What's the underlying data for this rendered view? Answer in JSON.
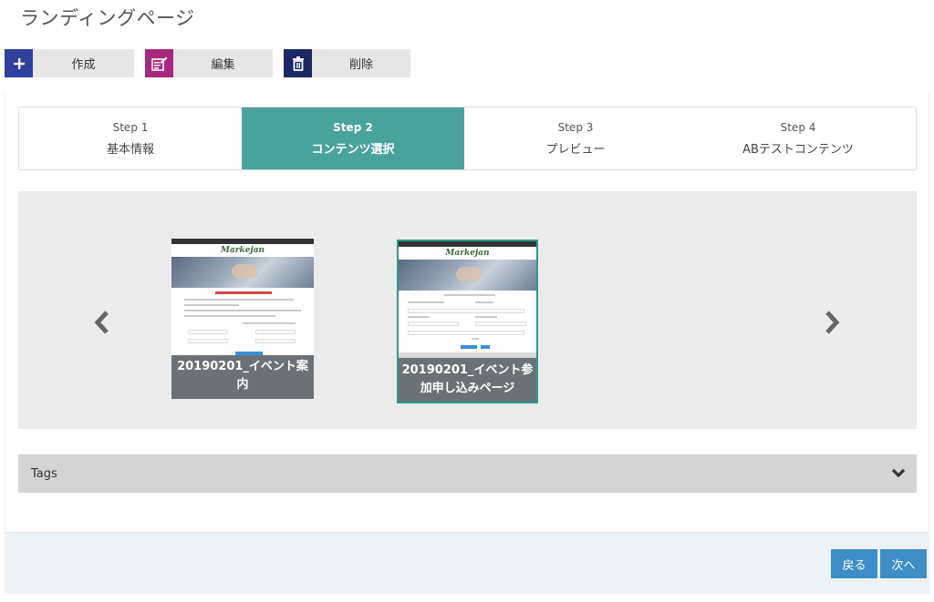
{
  "page": {
    "title": "ランディングページ"
  },
  "toolbar": {
    "create_label": "作成",
    "edit_label": "編集",
    "delete_label": "削除",
    "create_icon": "plus-icon",
    "edit_icon": "edit-icon",
    "delete_icon": "trash-icon"
  },
  "steps": [
    {
      "num": "Step 1",
      "name": "基本情報",
      "active": false
    },
    {
      "num": "Step 2",
      "name": "コンテンツ選択",
      "active": true
    },
    {
      "num": "Step 3",
      "name": "プレビュー",
      "active": false
    },
    {
      "num": "Step 4",
      "name": "ABテストコンテンツ",
      "active": false
    }
  ],
  "carousel": {
    "cards": [
      {
        "name": "20190201_イベント案内",
        "selected": false,
        "brand": "Markejan"
      },
      {
        "name": "20190201_イベント参加申し込みページ",
        "selected": true,
        "brand": "Markejan"
      }
    ]
  },
  "tags": {
    "label": "Tags"
  },
  "footer": {
    "back_label": "戻る",
    "next_label": "次へ"
  },
  "colors": {
    "accent_teal": "#4aa39b",
    "create_blue": "#2f3f9e",
    "edit_magenta": "#a8287e",
    "delete_navy": "#1c2766",
    "button_blue": "#3d8ec7"
  }
}
